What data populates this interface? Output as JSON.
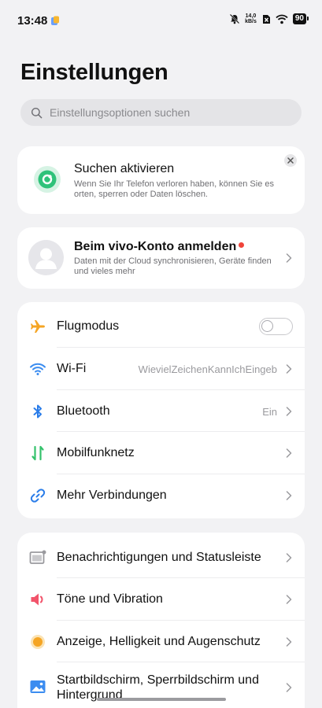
{
  "status_bar": {
    "time": "13:48",
    "net_speed_value": "14,0",
    "net_speed_unit": "kB/s",
    "battery": "90"
  },
  "page": {
    "title": "Einstellungen"
  },
  "search": {
    "placeholder": "Einstellungsoptionen suchen"
  },
  "find_card": {
    "title": "Suchen aktivieren",
    "description": "Wenn Sie Ihr Telefon verloren haben, können Sie es orten, sperren oder Daten löschen.",
    "accent_color": "#2fc27a"
  },
  "account_card": {
    "title": "Beim vivo-Konto anmelden",
    "description": "Daten mit der Cloud synchronisieren, Geräte finden und vieles mehr"
  },
  "connectivity": {
    "items": [
      {
        "label": "Flugmodus",
        "icon": "airplane-icon",
        "toggle_on": false
      },
      {
        "label": "Wi-Fi",
        "icon": "wifi-icon",
        "value": "WievielZeichenKannIchEingeb"
      },
      {
        "label": "Bluetooth",
        "icon": "bluetooth-icon",
        "value": "Ein"
      },
      {
        "label": "Mobilfunknetz",
        "icon": "mobile-network-icon"
      },
      {
        "label": "Mehr Verbindungen",
        "icon": "link-icon"
      }
    ]
  },
  "general": {
    "items": [
      {
        "label": "Benachrichtigungen und Statusleiste",
        "icon": "notification-icon"
      },
      {
        "label": "Töne und Vibration",
        "icon": "speaker-icon"
      },
      {
        "label": "Anzeige, Helligkeit und Augenschutz",
        "icon": "brightness-icon"
      },
      {
        "label": "Startbildschirm, Sperrbildschirm und Hintergrund",
        "icon": "wallpaper-icon"
      }
    ]
  },
  "colors": {
    "airplane": "#f5a524",
    "wifi": "#3b8cf0",
    "bluetooth": "#2b7de9",
    "mobile_up": "#34c26b",
    "mobile_down": "#34c26b",
    "link": "#2b7de9",
    "speaker": "#f2546b",
    "brightness": "#f5a524"
  }
}
